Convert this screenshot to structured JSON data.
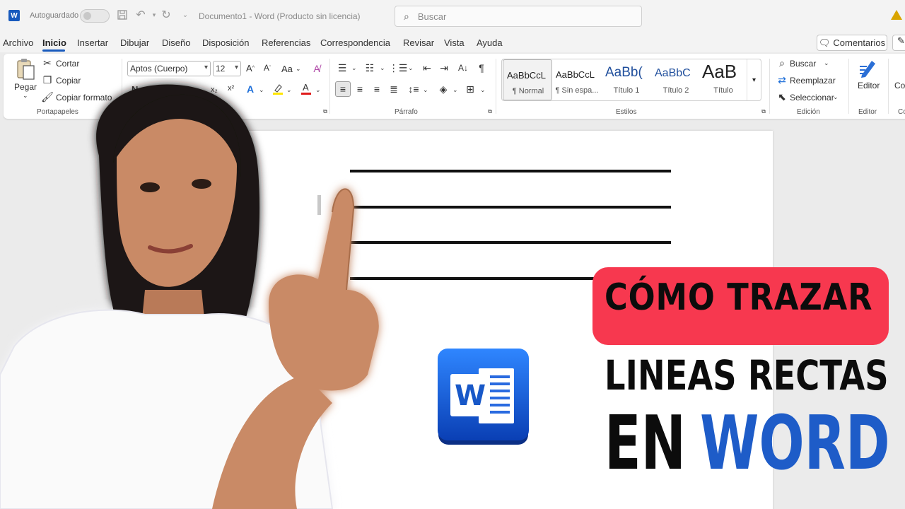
{
  "titlebar": {
    "app_badge": "W",
    "autosave_label": "Autoguardado",
    "document_title": "Documento1  -  Word (Producto sin licencia)",
    "search_placeholder": "Buscar"
  },
  "menu": {
    "items": [
      "Archivo",
      "Inicio",
      "Insertar",
      "Dibujar",
      "Diseño",
      "Disposición",
      "Referencias",
      "Correspondencia",
      "Revisar",
      "Vista",
      "Ayuda"
    ],
    "active": "Inicio",
    "comments_label": "Comentarios"
  },
  "ribbon": {
    "clipboard": {
      "paste": "Pegar",
      "cut": "Cortar",
      "copy": "Copiar",
      "format_painter": "Copiar formato",
      "group_label": "Portapapeles"
    },
    "font": {
      "name": "Aptos (Cuerpo)",
      "size": "12",
      "bold": "N",
      "subscript": "x₂",
      "superscript": "x²",
      "change_case": "Aa"
    },
    "paragraph": {
      "group_label": "Párrafo"
    },
    "styles": {
      "items": [
        {
          "sample": "AaBbCcL",
          "name": "¶ Normal"
        },
        {
          "sample": "AaBbCcL",
          "name": "¶ Sin espa..."
        },
        {
          "sample": "AaBb(",
          "name": "Título 1"
        },
        {
          "sample": "AaBbC",
          "name": "Título 2"
        },
        {
          "sample": "AaB",
          "name": "Título"
        }
      ],
      "group_label": "Estilos"
    },
    "editing": {
      "find": "Buscar",
      "replace": "Reemplazar",
      "select": "Seleccionar",
      "group_label": "Edición"
    },
    "editor": {
      "label": "Editor",
      "group_label": "Editor"
    },
    "cut_off": "Co"
  },
  "logo": {
    "letter": "W"
  },
  "headline": {
    "line1": "CÓMO TRAZAR",
    "line2": "LINEAS RECTAS",
    "line3a": "EN",
    "line3b": "WORD"
  },
  "colors": {
    "word_blue": "#185abd",
    "banner_red": "#f7384f",
    "headline_blue": "#1e5cc8"
  }
}
